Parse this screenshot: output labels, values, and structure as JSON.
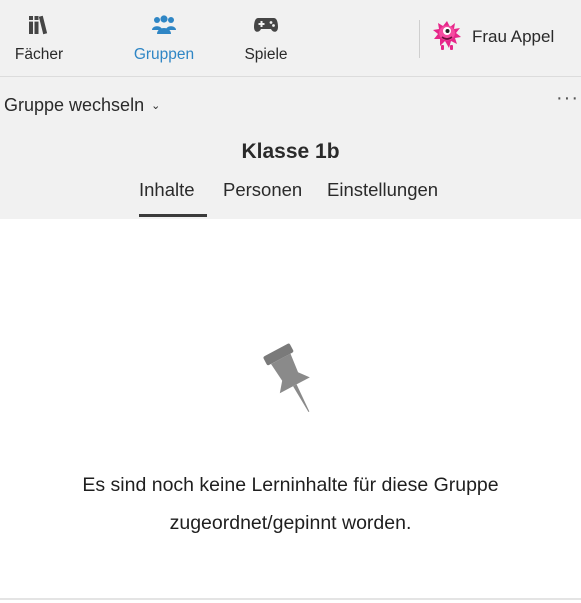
{
  "nav": {
    "items": [
      {
        "label": "Fächer",
        "icon": "books-icon"
      },
      {
        "label": "Gruppen",
        "icon": "group-icon",
        "active": true
      },
      {
        "label": "Spiele",
        "icon": "gamepad-icon"
      }
    ],
    "profile": {
      "name": "Frau Appel",
      "avatar": "pink-monster-avatar"
    }
  },
  "group": {
    "switch_label": "Gruppe wechseln",
    "more_label": "···",
    "title": "Klasse 1b",
    "tabs": [
      {
        "label": "Inhalte",
        "active": true
      },
      {
        "label": "Personen"
      },
      {
        "label": "Einstellungen"
      }
    ]
  },
  "empty_state": {
    "icon": "pin-icon",
    "line1": "Es sind noch keine Lerninhalte für diese Gruppe",
    "line2": "zugeordnet/gepinnt worden."
  },
  "colors": {
    "accent": "#2f86c5",
    "header_bg": "#f1f1f1",
    "avatar": "#e6278a"
  }
}
